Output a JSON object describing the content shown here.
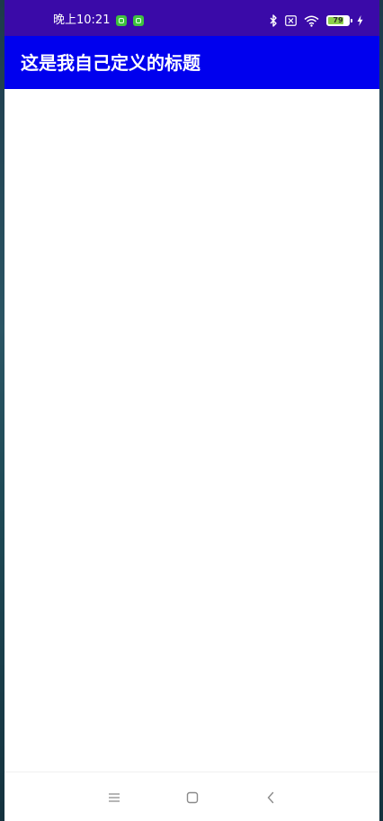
{
  "status_bar": {
    "time": "晚上10:21",
    "notification_icons": [
      "app-notification-icon",
      "app-notification-icon"
    ],
    "icons": [
      "bluetooth-icon",
      "no-sim-icon",
      "wifi-icon",
      "battery-icon",
      "charging-icon"
    ],
    "battery_level": "79",
    "battery_fraction": 0.79
  },
  "app_bar": {
    "title": "这是我自己定义的标题"
  },
  "nav_bar": {
    "buttons": [
      "menu-icon",
      "home-icon",
      "back-icon"
    ]
  },
  "colors": {
    "status_bar": "#3a0aa8",
    "app_bar": "#0000ee",
    "content": "#ffffff"
  }
}
